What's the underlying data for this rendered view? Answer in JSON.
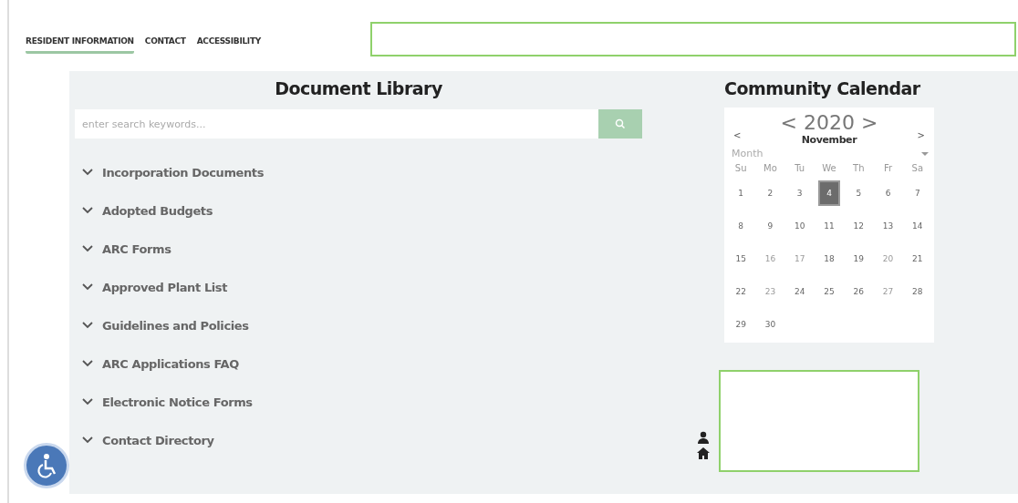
{
  "nav": {
    "tabs": [
      {
        "label": "RESIDENT INFORMATION",
        "selected": true
      },
      {
        "label": "CONTACT",
        "selected": false
      },
      {
        "label": "ACCESSIBILITY",
        "selected": false
      }
    ]
  },
  "library": {
    "title": "Document Library",
    "search": {
      "placeholder": "enter search keywords..."
    },
    "items": [
      {
        "label": "Incorporation Documents",
        "expanded": false
      },
      {
        "label": "Adopted Budgets",
        "expanded": false
      },
      {
        "label": "ARC Forms",
        "expanded": false
      },
      {
        "label": "Approved Plant List",
        "expanded": false
      },
      {
        "label": "Guidelines and Policies",
        "expanded": false
      },
      {
        "label": "ARC Applications FAQ",
        "expanded": false
      },
      {
        "label": "Electronic Notice Forms",
        "expanded": false
      },
      {
        "label": "Contact Directory",
        "expanded": false
      }
    ]
  },
  "calendar": {
    "title": "Community Calendar",
    "prev": "<",
    "next": ">",
    "year": "< 2020 >",
    "month": "November",
    "view": "Month",
    "weekdays": [
      "Su",
      "Mo",
      "Tu",
      "We",
      "Th",
      "Fr",
      "Sa"
    ],
    "weeks": [
      [
        {
          "label": "1",
          "selected": false,
          "muted": false
        },
        {
          "label": "2",
          "selected": false,
          "muted": false
        },
        {
          "label": "3",
          "selected": false,
          "muted": false
        },
        {
          "label": "4",
          "selected": true,
          "muted": false
        },
        {
          "label": "5",
          "selected": false,
          "muted": false
        },
        {
          "label": "6",
          "selected": false,
          "muted": false
        },
        {
          "label": "7",
          "selected": false,
          "muted": false
        }
      ],
      [
        {
          "label": "8",
          "selected": false,
          "muted": false
        },
        {
          "label": "9",
          "selected": false,
          "muted": false
        },
        {
          "label": "10",
          "selected": false,
          "muted": false
        },
        {
          "label": "11",
          "selected": false,
          "muted": false
        },
        {
          "label": "12",
          "selected": false,
          "muted": false
        },
        {
          "label": "13",
          "selected": false,
          "muted": false
        },
        {
          "label": "14",
          "selected": false,
          "muted": false
        }
      ],
      [
        {
          "label": "15",
          "selected": false,
          "muted": false
        },
        {
          "label": "16",
          "selected": false,
          "muted": true
        },
        {
          "label": "17",
          "selected": false,
          "muted": true
        },
        {
          "label": "18",
          "selected": false,
          "muted": false
        },
        {
          "label": "19",
          "selected": false,
          "muted": false
        },
        {
          "label": "20",
          "selected": false,
          "muted": true
        },
        {
          "label": "21",
          "selected": false,
          "muted": false
        }
      ],
      [
        {
          "label": "22",
          "selected": false,
          "muted": false
        },
        {
          "label": "23",
          "selected": false,
          "muted": true
        },
        {
          "label": "24",
          "selected": false,
          "muted": false
        },
        {
          "label": "25",
          "selected": false,
          "muted": false
        },
        {
          "label": "26",
          "selected": false,
          "muted": false
        },
        {
          "label": "27",
          "selected": false,
          "muted": true
        },
        {
          "label": "28",
          "selected": false,
          "muted": false
        }
      ],
      [
        {
          "label": "29",
          "selected": false,
          "muted": false
        },
        {
          "label": "30",
          "selected": false,
          "muted": false
        }
      ]
    ]
  }
}
